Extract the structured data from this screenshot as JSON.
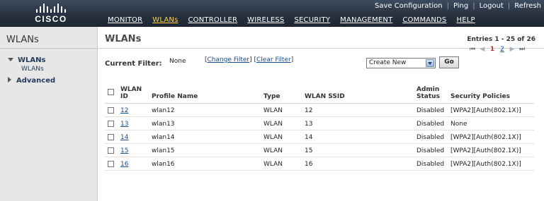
{
  "header": {
    "logo_text": "CISCO",
    "top_links": [
      "Save Configuration",
      "Ping",
      "Logout",
      "Refresh"
    ],
    "nav": [
      {
        "label": "MONITOR",
        "active": false
      },
      {
        "label": "WLANs",
        "active": true
      },
      {
        "label": "CONTROLLER",
        "active": false
      },
      {
        "label": "WIRELESS",
        "active": false
      },
      {
        "label": "SECURITY",
        "active": false
      },
      {
        "label": "MANAGEMENT",
        "active": false
      },
      {
        "label": "COMMANDS",
        "active": false
      },
      {
        "label": "HELP",
        "active": false
      }
    ]
  },
  "sidebar": {
    "title": "WLANs",
    "items": [
      {
        "label": "WLANs",
        "expanded": true,
        "sub": "WLANs"
      },
      {
        "label": "Advanced",
        "expanded": false
      }
    ]
  },
  "main": {
    "title": "WLANs",
    "entries": "Entries 1 - 25 of 26",
    "pages": [
      "1",
      "2"
    ],
    "current_page": "1",
    "filter_label": "Current Filter:",
    "filter_value": "None",
    "change_filter": "Change Filter",
    "clear_filter": "Clear Filter",
    "action_select": "Create New",
    "go_label": "Go",
    "columns": [
      "WLAN ID",
      "Profile Name",
      "Type",
      "WLAN SSID",
      "Admin Status",
      "Security Policies"
    ],
    "columns_split": {
      "wlan_id": [
        "WLAN",
        "ID"
      ],
      "admin_status": [
        "Admin",
        "Status"
      ]
    },
    "rows": [
      {
        "id": "12",
        "profile": "wlan12",
        "type": "WLAN",
        "ssid": "12",
        "status": "Disabled",
        "security": "[WPA2][Auth(802.1X)]"
      },
      {
        "id": "13",
        "profile": "wlan13",
        "type": "WLAN",
        "ssid": "13",
        "status": "Disabled",
        "security": "None"
      },
      {
        "id": "14",
        "profile": "wlan14",
        "type": "WLAN",
        "ssid": "14",
        "status": "Disabled",
        "security": "[WPA2][Auth(802.1X)]"
      },
      {
        "id": "15",
        "profile": "wlan15",
        "type": "WLAN",
        "ssid": "15",
        "status": "Disabled",
        "security": "[WPA2][Auth(802.1X)]"
      },
      {
        "id": "16",
        "profile": "wlan16",
        "type": "WLAN",
        "ssid": "16",
        "status": "Disabled",
        "security": "[WPA2][Auth(802.1X)]"
      }
    ]
  }
}
